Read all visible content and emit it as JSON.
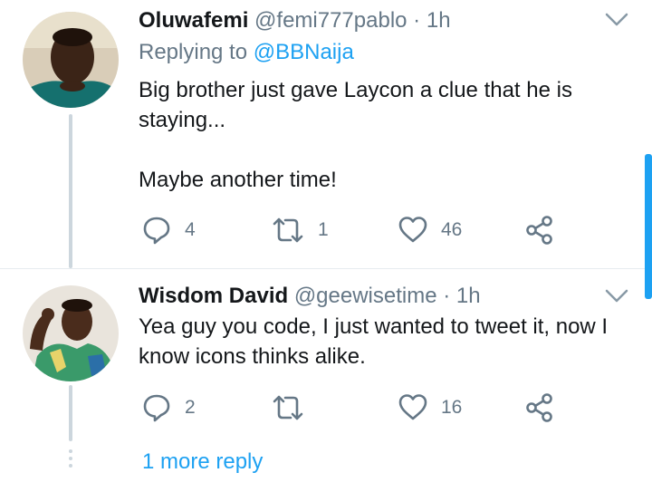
{
  "tweets": [
    {
      "name": "Oluwafemi",
      "handle": "@femi777pablo",
      "dot": "·",
      "time": "1h",
      "replying_prefix": "Replying to",
      "replying_to": "@BBNaija",
      "text_line1": "Big brother just gave Laycon a clue that he is",
      "text_line2": "staying...",
      "text_line3": "Maybe another time!",
      "replies": "4",
      "retweets": "1",
      "likes": "46"
    },
    {
      "name": "Wisdom David",
      "handle": "@geewisetime",
      "dot": "·",
      "time": "1h",
      "text_line1": "Yea guy you code, I just wanted to tweet it, now I",
      "text_line2": "know icons thinks alike.",
      "replies": "2",
      "retweets": "",
      "likes": "16"
    }
  ],
  "more_replies": "1 more reply",
  "colors": {
    "accent": "#1da1f2",
    "muted": "#657786",
    "text": "#14171a",
    "thread": "#ccd6dd"
  },
  "icons": [
    "reply-icon",
    "retweet-icon",
    "like-icon",
    "share-icon",
    "chevron-down-icon"
  ]
}
